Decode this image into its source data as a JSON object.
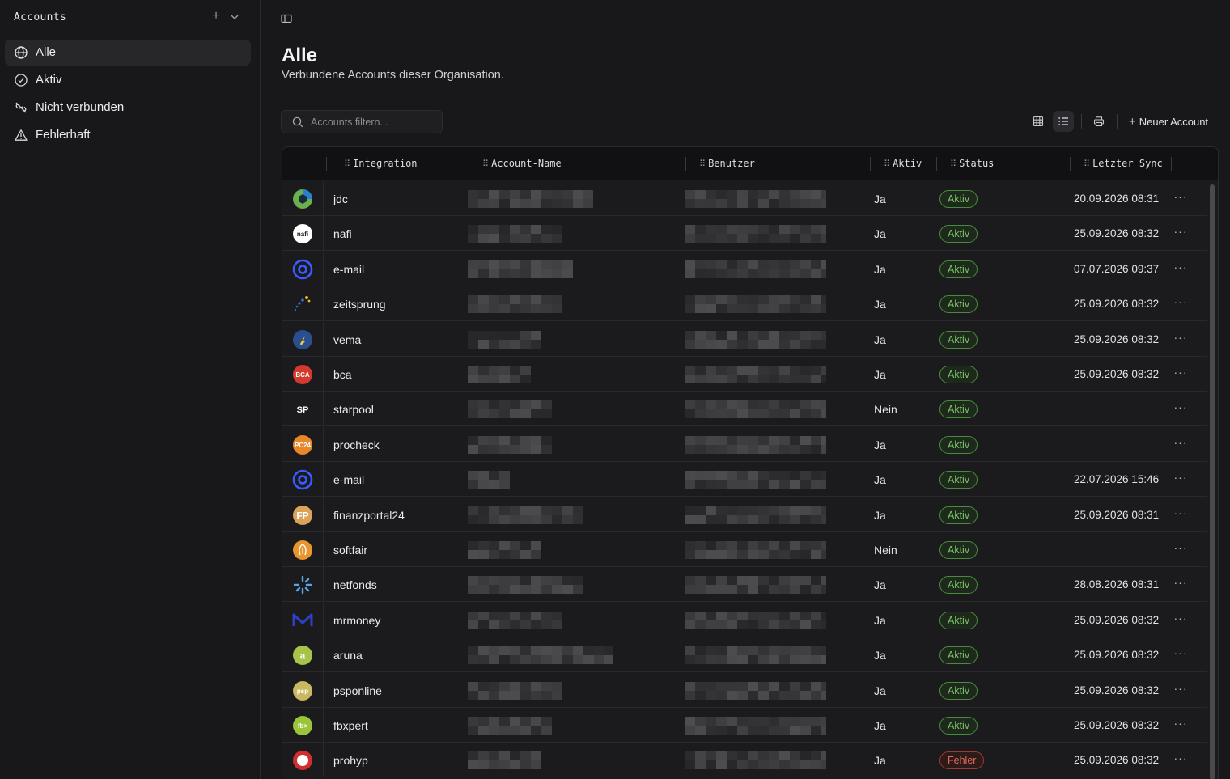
{
  "sidebar": {
    "title": "Accounts",
    "items": [
      {
        "label": "Alle",
        "icon": "globe-icon",
        "active": true
      },
      {
        "label": "Aktiv",
        "icon": "check-circle-icon",
        "active": false
      },
      {
        "label": "Nicht verbunden",
        "icon": "link-off-icon",
        "active": false
      },
      {
        "label": "Fehlerhaft",
        "icon": "warning-icon",
        "active": false
      }
    ]
  },
  "page": {
    "title": "Alle",
    "subtitle": "Verbundene Accounts dieser Organisation."
  },
  "search": {
    "placeholder": "Accounts filtern..."
  },
  "toolbar": {
    "new_account_label": "Neuer Account"
  },
  "table": {
    "columns": [
      "Integration",
      "Account-Name",
      "Benutzer",
      "Aktiv",
      "Status",
      "Letzter Sync"
    ],
    "rows": [
      {
        "integration": "jdc",
        "aktiv": "Ja",
        "status": "Aktiv",
        "sync": "20.09.2026 08:31",
        "logo_color": "#2b7fd0",
        "logo_text": ""
      },
      {
        "integration": "nafi",
        "aktiv": "Ja",
        "status": "Aktiv",
        "sync": "25.09.2026 08:32",
        "logo_color": "#ffffff",
        "logo_text": "nafi"
      },
      {
        "integration": "e-mail",
        "aktiv": "Ja",
        "status": "Aktiv",
        "sync": "07.07.2026 09:37",
        "logo_color": "#3a5bff",
        "logo_text": "@"
      },
      {
        "integration": "zeitsprung",
        "aktiv": "Ja",
        "status": "Aktiv",
        "sync": "25.09.2026 08:32",
        "logo_color": "#1b1b1d",
        "logo_text": ""
      },
      {
        "integration": "vema",
        "aktiv": "Ja",
        "status": "Aktiv",
        "sync": "25.09.2026 08:32",
        "logo_color": "#2a4f8f",
        "logo_text": ""
      },
      {
        "integration": "bca",
        "aktiv": "Ja",
        "status": "Aktiv",
        "sync": "25.09.2026 08:32",
        "logo_color": "#d23a2f",
        "logo_text": "BCA"
      },
      {
        "integration": "starpool",
        "aktiv": "Nein",
        "status": "Aktiv",
        "sync": "",
        "logo_color": "#1b1b1d",
        "logo_text": "SP"
      },
      {
        "integration": "procheck",
        "aktiv": "Ja",
        "status": "Aktiv",
        "sync": "",
        "logo_color": "#e8862a",
        "logo_text": "PC24"
      },
      {
        "integration": "e-mail",
        "aktiv": "Ja",
        "status": "Aktiv",
        "sync": "22.07.2026 15:46",
        "logo_color": "#3a5bff",
        "logo_text": "@"
      },
      {
        "integration": "finanzportal24",
        "aktiv": "Ja",
        "status": "Aktiv",
        "sync": "25.09.2026 08:31",
        "logo_color": "#d9a45a",
        "logo_text": "FP"
      },
      {
        "integration": "softfair",
        "aktiv": "Nein",
        "status": "Aktiv",
        "sync": "",
        "logo_color": "#e8952f",
        "logo_text": ""
      },
      {
        "integration": "netfonds",
        "aktiv": "Ja",
        "status": "Aktiv",
        "sync": "28.08.2026 08:31",
        "logo_color": "#1b1b1d",
        "logo_text": ""
      },
      {
        "integration": "mrmoney",
        "aktiv": "Ja",
        "status": "Aktiv",
        "sync": "25.09.2026 08:32",
        "logo_color": "#1b1b1d",
        "logo_text": "M"
      },
      {
        "integration": "aruna",
        "aktiv": "Ja",
        "status": "Aktiv",
        "sync": "25.09.2026 08:32",
        "logo_color": "#a8c24a",
        "logo_text": "a"
      },
      {
        "integration": "psponline",
        "aktiv": "Ja",
        "status": "Aktiv",
        "sync": "25.09.2026 08:32",
        "logo_color": "#c9b860",
        "logo_text": "psp"
      },
      {
        "integration": "fbxpert",
        "aktiv": "Ja",
        "status": "Aktiv",
        "sync": "25.09.2026 08:32",
        "logo_color": "#9cc43a",
        "logo_text": "fb>"
      },
      {
        "integration": "prohyp",
        "aktiv": "Ja",
        "status": "Fehler",
        "sync": "25.09.2026 08:32",
        "logo_color": "#d12f2f",
        "logo_text": ""
      }
    ]
  },
  "colors": {
    "background": "#18181a",
    "status_ok": "#7cc36a",
    "status_error": "#e06a5e"
  }
}
